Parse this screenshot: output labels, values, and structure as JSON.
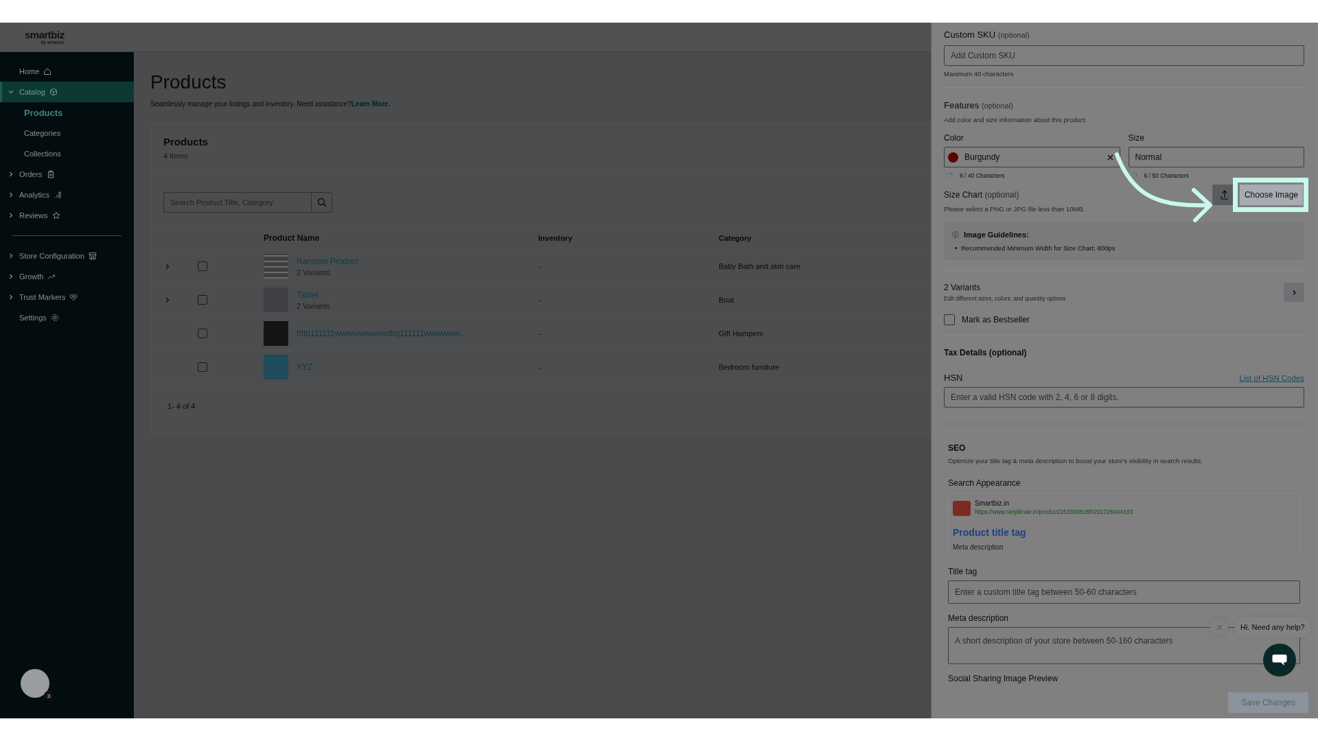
{
  "logo": {
    "text": "smartbiz",
    "tagline": "by amazon"
  },
  "sidebar": {
    "groups": [
      {
        "items": [
          {
            "label": "Home",
            "selected": false
          },
          {
            "label": "Catalog",
            "selected": true,
            "expanded": true,
            "children": [
              {
                "label": "Products",
                "selected": true
              },
              {
                "label": "Categories",
                "selected": false
              },
              {
                "label": "Collections",
                "selected": false
              }
            ]
          },
          {
            "label": "Orders",
            "selected": false,
            "expanded": false
          },
          {
            "label": "Analytics",
            "selected": false,
            "expanded": false
          },
          {
            "label": "Reviews",
            "selected": false,
            "expanded": false
          }
        ]
      },
      {
        "items": [
          {
            "label": "Store Configuration",
            "selected": false,
            "expanded": false
          },
          {
            "label": "Growth",
            "selected": false,
            "expanded": false
          },
          {
            "label": "Trust Markers",
            "selected": false,
            "expanded": false
          },
          {
            "label": "Settings",
            "selected": false
          }
        ]
      }
    ],
    "account": {
      "badge": "3"
    }
  },
  "page": {
    "title": "Products",
    "subtitle": "Seamlessly manage your listings and inventory. Need assistance?",
    "link": "Learn More."
  },
  "card": {
    "title": "Products",
    "count": "4 items",
    "search": {
      "placeholder": "Search Product Title, Category"
    },
    "table": {
      "columns": [
        "Product Name",
        "Inventory",
        "Category"
      ],
      "rows": [
        {
          "name": "Random Product",
          "variants": "2 Variants",
          "inventory": "-",
          "category": "Baby Bath and skin care",
          "expanded": false,
          "checked": false
        },
        {
          "name": "Tablet",
          "variants": "2 Variants",
          "inventory": "-",
          "category": "Boat",
          "expanded": false,
          "checked": false
        },
        {
          "name": "ttttq111111wwwwwwwwwtttq111111wwwwww...",
          "inventory": "-",
          "category": "Gift Hampers",
          "checked": false
        },
        {
          "name": "XYZ",
          "inventory": "-",
          "category": "Bedroom furniture",
          "checked": false
        }
      ]
    },
    "pagination": "1- 4 of 4"
  },
  "panel": {
    "custom_sku": {
      "label": "Custom SKU",
      "optional": "(optional)",
      "placeholder": "Add Custom SKU",
      "hint": "Maximum 40 characters"
    },
    "features": {
      "title": "Features",
      "optional": "(optional)",
      "description": "Add color and size information about this product",
      "color": {
        "label": "Color",
        "value": "Burgundy",
        "color": "#5c0404",
        "counter": "8 / 40 Characters"
      },
      "size": {
        "label": "Size",
        "value": "Normal",
        "counter": "6 / 50 Characters"
      }
    },
    "size_chart": {
      "label": "Size Chart",
      "optional": "(optional)",
      "hint": "Please select a PNG or JPG file less than 10MB.",
      "button": "Choose Image",
      "guidelines_title": "Image Guidelines:",
      "guidelines": [
        "Recommended Minimum Width for Size Chart: 800px"
      ]
    },
    "variants": {
      "title": "2 Variants",
      "description": "Edit different sizes, colors, and quantity options"
    },
    "bestseller": {
      "label": "Mark as Bestseller",
      "checked": false
    },
    "tax": {
      "title": "Tax Details (optional)",
      "hsn_label": "HSN",
      "link": "List of HSN Codes",
      "placeholder": "Enter a valid HSN code with 2, 4, 6 or 8 digits."
    },
    "seo": {
      "title": "SEO",
      "description": "Optimize your title tag & meta description to boost your store's visibility in search results.",
      "appearance_label": "Search Appearance",
      "preview": {
        "site": "Smartbiz.in",
        "url": "https://www.ranjitknair.in/product/2533938c8f0201726044183",
        "title": "Product title tag",
        "description": "Meta description"
      },
      "title_tag": {
        "label": "Title tag",
        "placeholder": "Enter a custom title tag between 50-60 characters"
      },
      "meta": {
        "label": "Meta description",
        "placeholder": "A short description of your store between 50-160 characters"
      },
      "social_label": "Social Sharing Image Preview"
    },
    "save_button": {
      "label": "Save Changes",
      "disabled": true
    }
  },
  "chat": {
    "bubble": "Hi. Need any help?"
  }
}
